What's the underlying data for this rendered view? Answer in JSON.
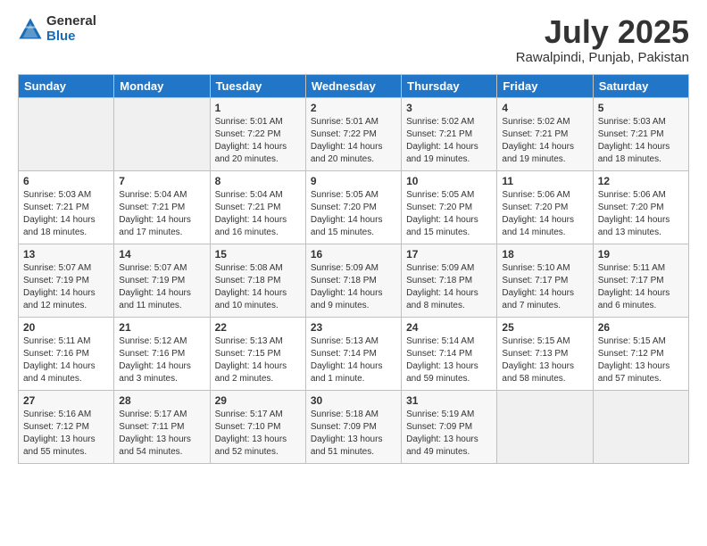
{
  "logo": {
    "general": "General",
    "blue": "Blue"
  },
  "title": {
    "month": "July 2025",
    "location": "Rawalpindi, Punjab, Pakistan"
  },
  "headers": [
    "Sunday",
    "Monday",
    "Tuesday",
    "Wednesday",
    "Thursday",
    "Friday",
    "Saturday"
  ],
  "weeks": [
    [
      {
        "day": "",
        "info": ""
      },
      {
        "day": "",
        "info": ""
      },
      {
        "day": "1",
        "info": "Sunrise: 5:01 AM\nSunset: 7:22 PM\nDaylight: 14 hours\nand 20 minutes."
      },
      {
        "day": "2",
        "info": "Sunrise: 5:01 AM\nSunset: 7:22 PM\nDaylight: 14 hours\nand 20 minutes."
      },
      {
        "day": "3",
        "info": "Sunrise: 5:02 AM\nSunset: 7:21 PM\nDaylight: 14 hours\nand 19 minutes."
      },
      {
        "day": "4",
        "info": "Sunrise: 5:02 AM\nSunset: 7:21 PM\nDaylight: 14 hours\nand 19 minutes."
      },
      {
        "day": "5",
        "info": "Sunrise: 5:03 AM\nSunset: 7:21 PM\nDaylight: 14 hours\nand 18 minutes."
      }
    ],
    [
      {
        "day": "6",
        "info": "Sunrise: 5:03 AM\nSunset: 7:21 PM\nDaylight: 14 hours\nand 18 minutes."
      },
      {
        "day": "7",
        "info": "Sunrise: 5:04 AM\nSunset: 7:21 PM\nDaylight: 14 hours\nand 17 minutes."
      },
      {
        "day": "8",
        "info": "Sunrise: 5:04 AM\nSunset: 7:21 PM\nDaylight: 14 hours\nand 16 minutes."
      },
      {
        "day": "9",
        "info": "Sunrise: 5:05 AM\nSunset: 7:20 PM\nDaylight: 14 hours\nand 15 minutes."
      },
      {
        "day": "10",
        "info": "Sunrise: 5:05 AM\nSunset: 7:20 PM\nDaylight: 14 hours\nand 15 minutes."
      },
      {
        "day": "11",
        "info": "Sunrise: 5:06 AM\nSunset: 7:20 PM\nDaylight: 14 hours\nand 14 minutes."
      },
      {
        "day": "12",
        "info": "Sunrise: 5:06 AM\nSunset: 7:20 PM\nDaylight: 14 hours\nand 13 minutes."
      }
    ],
    [
      {
        "day": "13",
        "info": "Sunrise: 5:07 AM\nSunset: 7:19 PM\nDaylight: 14 hours\nand 12 minutes."
      },
      {
        "day": "14",
        "info": "Sunrise: 5:07 AM\nSunset: 7:19 PM\nDaylight: 14 hours\nand 11 minutes."
      },
      {
        "day": "15",
        "info": "Sunrise: 5:08 AM\nSunset: 7:18 PM\nDaylight: 14 hours\nand 10 minutes."
      },
      {
        "day": "16",
        "info": "Sunrise: 5:09 AM\nSunset: 7:18 PM\nDaylight: 14 hours\nand 9 minutes."
      },
      {
        "day": "17",
        "info": "Sunrise: 5:09 AM\nSunset: 7:18 PM\nDaylight: 14 hours\nand 8 minutes."
      },
      {
        "day": "18",
        "info": "Sunrise: 5:10 AM\nSunset: 7:17 PM\nDaylight: 14 hours\nand 7 minutes."
      },
      {
        "day": "19",
        "info": "Sunrise: 5:11 AM\nSunset: 7:17 PM\nDaylight: 14 hours\nand 6 minutes."
      }
    ],
    [
      {
        "day": "20",
        "info": "Sunrise: 5:11 AM\nSunset: 7:16 PM\nDaylight: 14 hours\nand 4 minutes."
      },
      {
        "day": "21",
        "info": "Sunrise: 5:12 AM\nSunset: 7:16 PM\nDaylight: 14 hours\nand 3 minutes."
      },
      {
        "day": "22",
        "info": "Sunrise: 5:13 AM\nSunset: 7:15 PM\nDaylight: 14 hours\nand 2 minutes."
      },
      {
        "day": "23",
        "info": "Sunrise: 5:13 AM\nSunset: 7:14 PM\nDaylight: 14 hours\nand 1 minute."
      },
      {
        "day": "24",
        "info": "Sunrise: 5:14 AM\nSunset: 7:14 PM\nDaylight: 13 hours\nand 59 minutes."
      },
      {
        "day": "25",
        "info": "Sunrise: 5:15 AM\nSunset: 7:13 PM\nDaylight: 13 hours\nand 58 minutes."
      },
      {
        "day": "26",
        "info": "Sunrise: 5:15 AM\nSunset: 7:12 PM\nDaylight: 13 hours\nand 57 minutes."
      }
    ],
    [
      {
        "day": "27",
        "info": "Sunrise: 5:16 AM\nSunset: 7:12 PM\nDaylight: 13 hours\nand 55 minutes."
      },
      {
        "day": "28",
        "info": "Sunrise: 5:17 AM\nSunset: 7:11 PM\nDaylight: 13 hours\nand 54 minutes."
      },
      {
        "day": "29",
        "info": "Sunrise: 5:17 AM\nSunset: 7:10 PM\nDaylight: 13 hours\nand 52 minutes."
      },
      {
        "day": "30",
        "info": "Sunrise: 5:18 AM\nSunset: 7:09 PM\nDaylight: 13 hours\nand 51 minutes."
      },
      {
        "day": "31",
        "info": "Sunrise: 5:19 AM\nSunset: 7:09 PM\nDaylight: 13 hours\nand 49 minutes."
      },
      {
        "day": "",
        "info": ""
      },
      {
        "day": "",
        "info": ""
      }
    ]
  ]
}
